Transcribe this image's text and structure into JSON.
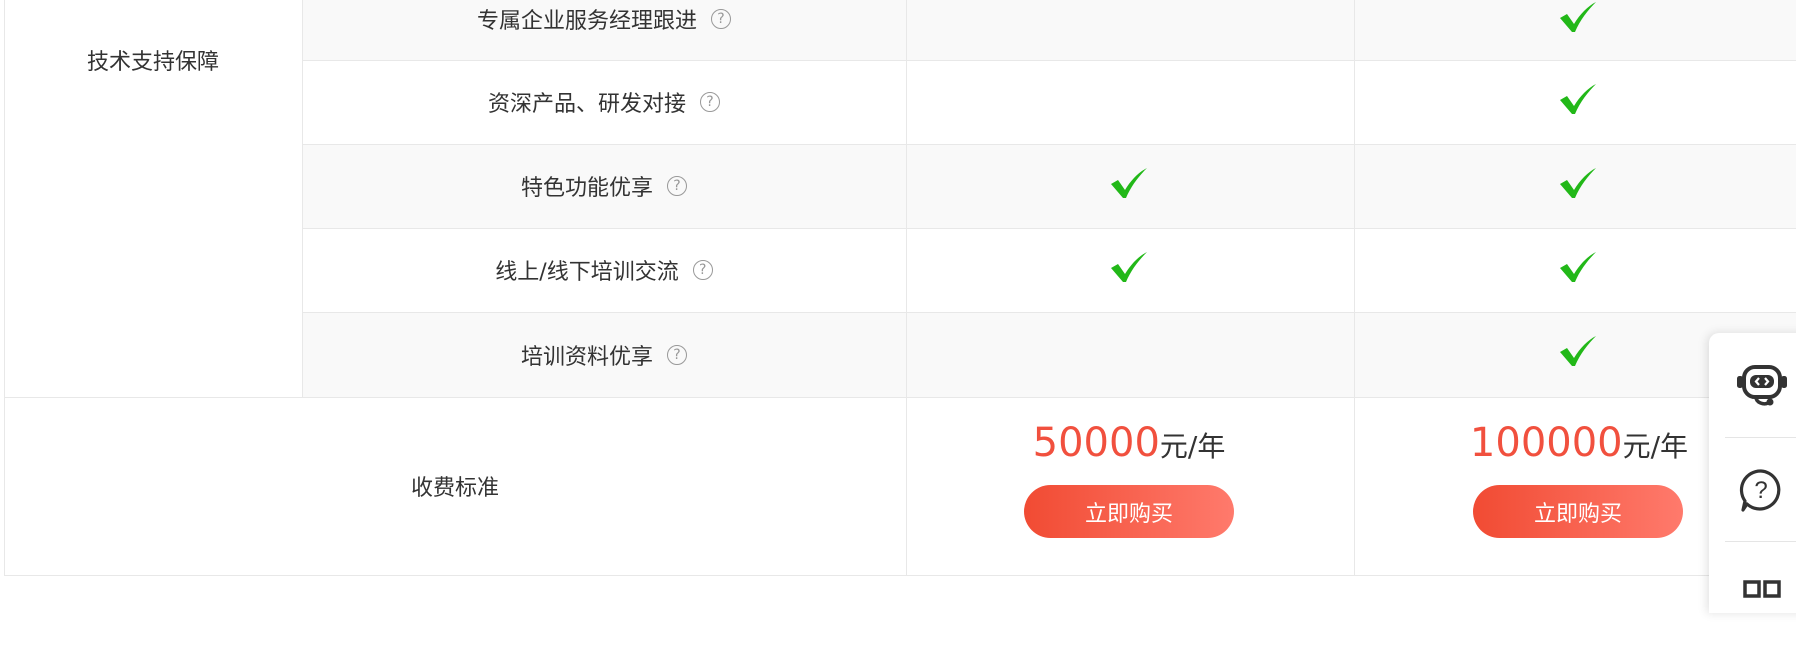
{
  "category": "技术支持保障",
  "features": [
    {
      "label": "专属企业服务经理跟进",
      "plan1": false,
      "plan2": true
    },
    {
      "label": "资深产品、研发对接",
      "plan1": false,
      "plan2": true
    },
    {
      "label": "特色功能优享",
      "plan1": true,
      "plan2": true
    },
    {
      "label": "线上/线下培训交流",
      "plan1": true,
      "plan2": true
    },
    {
      "label": "培训资料优享",
      "plan1": false,
      "plan2": true
    }
  ],
  "help_icon": "?",
  "fee_label": "收费标准",
  "plans": [
    {
      "price": "50000",
      "unit": "元/年",
      "buy_label": "立即购买"
    },
    {
      "price": "100000",
      "unit": "元/年",
      "buy_label": "立即购买"
    }
  ],
  "colors": {
    "price": "#f1503e",
    "check": "#22b818",
    "button": "#f14b33"
  },
  "sidebar": {
    "items": [
      {
        "icon": "customer-service-robot-icon"
      },
      {
        "icon": "help-circle-icon"
      },
      {
        "icon": "qr-code-icon"
      }
    ]
  }
}
